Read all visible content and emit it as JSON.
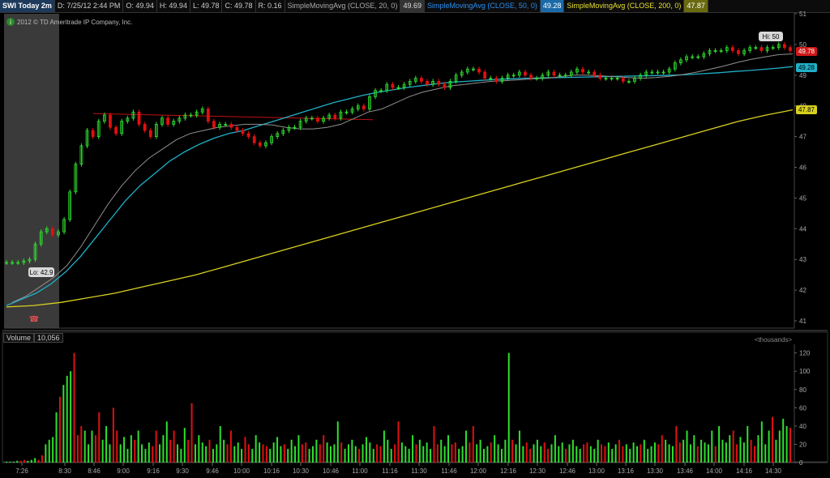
{
  "header": {
    "symbol": "SWI Today 2m",
    "date": "D: 7/25/12 2:44 PM",
    "open": "O: 49.94",
    "high": "H: 49.94",
    "low": "L: 49.78",
    "close": "C: 49.78",
    "range": "R: 0.16",
    "sma20_label": "SimpleMovingAvg (CLOSE, 20, 0)",
    "sma20_value": "49.69",
    "sma50_label": "SimpleMovingAvg (CLOSE, 50, 0)",
    "sma50_value": "49.28",
    "sma200_label": "SimpleMovingAvg (CLOSE, 200, 0)",
    "sma200_value": "47.87"
  },
  "copyright": "2012 © TD Ameritrade IP Company, Inc.",
  "annotations": {
    "hi": "Hi: 50",
    "lo": "Lo: 42.9"
  },
  "price_tags": {
    "last": "49.78",
    "sma50": "49.28",
    "sma200": "47.87"
  },
  "volume_panel": {
    "label": "Volume",
    "value": "10,056",
    "units": "<thousands>"
  },
  "colors": {
    "up": "#2ee02e",
    "down": "#e01010",
    "sma20": "#909090",
    "sma50": "#20b0c8",
    "sma200": "#d8d020",
    "resistance": "#c01010"
  },
  "chart_data": {
    "type": "candlestick",
    "price_axis": {
      "ylim": [
        41,
        51
      ],
      "ticks": [
        41,
        42,
        43,
        44,
        45,
        46,
        47,
        48,
        49,
        50,
        51
      ]
    },
    "volume_axis": {
      "ylim": [
        0,
        125
      ],
      "ticks": [
        0,
        20,
        40,
        60,
        80,
        100,
        120
      ]
    },
    "time_ticks": [
      "7:26",
      "8:30",
      "8:46",
      "9:00",
      "9:16",
      "9:30",
      "9:46",
      "10:00",
      "10:16",
      "10:30",
      "10:46",
      "11:00",
      "11:16",
      "11:30",
      "11:46",
      "12:00",
      "12:16",
      "12:30",
      "12:46",
      "13:00",
      "13:16",
      "13:30",
      "13:46",
      "14:00",
      "14:16",
      "14:30"
    ],
    "close_series": [
      42.9,
      42.9,
      42.9,
      42.95,
      43.0,
      43.5,
      43.9,
      44.0,
      43.8,
      43.9,
      44.3,
      45.2,
      46.1,
      46.7,
      47.2,
      47.0,
      47.5,
      47.7,
      47.3,
      47.1,
      47.5,
      47.6,
      47.8,
      47.4,
      47.2,
      47.0,
      47.4,
      47.6,
      47.4,
      47.5,
      47.6,
      47.7,
      47.7,
      47.8,
      47.9,
      47.5,
      47.3,
      47.4,
      47.4,
      47.3,
      47.2,
      47.1,
      47.0,
      46.8,
      46.7,
      46.8,
      47.0,
      47.1,
      47.2,
      47.3,
      47.3,
      47.5,
      47.6,
      47.6,
      47.5,
      47.6,
      47.7,
      47.6,
      47.8,
      47.8,
      47.9,
      48.0,
      47.9,
      48.3,
      48.5,
      48.5,
      48.7,
      48.6,
      48.6,
      48.7,
      48.8,
      48.9,
      48.8,
      48.7,
      48.8,
      48.7,
      48.6,
      48.8,
      49.0,
      49.1,
      49.2,
      49.2,
      49.1,
      48.9,
      48.9,
      48.8,
      48.9,
      49.0,
      49.0,
      49.1,
      49.0,
      48.9,
      48.9,
      49.0,
      49.1,
      49.0,
      49.0,
      49.0,
      49.1,
      49.2,
      49.1,
      49.1,
      49.0,
      48.9,
      48.9,
      48.9,
      48.9,
      48.8,
      48.8,
      48.9,
      49.0,
      49.1,
      49.1,
      49.1,
      49.1,
      49.2,
      49.4,
      49.5,
      49.6,
      49.6,
      49.6,
      49.7,
      49.8,
      49.8,
      49.8,
      49.9,
      49.8,
      49.7,
      49.8,
      49.9,
      49.9,
      49.8,
      49.9,
      49.9,
      50.0,
      49.9,
      49.8
    ],
    "sma20_series": [
      41.6,
      41.8,
      42.1,
      42.4,
      42.8,
      43.4,
      44.1,
      44.8,
      45.4,
      45.9,
      46.3,
      46.6,
      46.9,
      47.1,
      47.2,
      47.3,
      47.35,
      47.4,
      47.4,
      47.38,
      47.3,
      47.25,
      47.25,
      47.3,
      47.4,
      47.6,
      47.8,
      47.9,
      48.1,
      48.3,
      48.45,
      48.55,
      48.65,
      48.7,
      48.75,
      48.8,
      48.82,
      48.85,
      48.88,
      48.9,
      48.95,
      49.0,
      49.0,
      48.98,
      48.95,
      48.92,
      48.9,
      48.92,
      48.96,
      49.02,
      49.1,
      49.2,
      49.3,
      49.42,
      49.52,
      49.6,
      49.67,
      49.69
    ],
    "sma50_series": [
      41.5,
      41.7,
      41.9,
      42.2,
      42.6,
      43.1,
      43.7,
      44.3,
      44.9,
      45.4,
      45.8,
      46.2,
      46.5,
      46.75,
      46.95,
      47.1,
      47.2,
      47.35,
      47.5,
      47.65,
      47.8,
      47.95,
      48.1,
      48.22,
      48.34,
      48.44,
      48.52,
      48.6,
      48.66,
      48.72,
      48.77,
      48.8,
      48.83,
      48.86,
      48.88,
      48.9,
      48.91,
      48.92,
      48.93,
      48.94,
      48.95,
      48.96,
      48.97,
      48.98,
      48.99,
      49.0,
      49.02,
      49.05,
      49.08,
      49.12,
      49.15,
      49.19,
      49.23,
      49.28
    ],
    "sma200_series": [
      41.45,
      41.5,
      41.6,
      41.75,
      41.9,
      42.1,
      42.3,
      42.5,
      42.75,
      43.0,
      43.25,
      43.5,
      43.75,
      44.0,
      44.25,
      44.5,
      44.75,
      45.0,
      45.25,
      45.5,
      45.75,
      46.0,
      46.25,
      46.5,
      46.75,
      47.0,
      47.25,
      47.5,
      47.7,
      47.87
    ],
    "resistance_line": {
      "from": 47.75,
      "to": 47.55
    },
    "volume_values": [
      1,
      1,
      1,
      2,
      2,
      3,
      2,
      3,
      5,
      3,
      8,
      20,
      25,
      28,
      55,
      72,
      85,
      95,
      100,
      120,
      30,
      40,
      35,
      20,
      35,
      30,
      55,
      25,
      40,
      20,
      60,
      35,
      20,
      28,
      15,
      30,
      25,
      35,
      20,
      15,
      22,
      18,
      35,
      20,
      30,
      45,
      25,
      35,
      20,
      15,
      38,
      25,
      65,
      20,
      30,
      22,
      18,
      25,
      15,
      20,
      40,
      25,
      20,
      35,
      18,
      22,
      15,
      28,
      20,
      15,
      30,
      22,
      20,
      18,
      15,
      22,
      28,
      18,
      20,
      15,
      25,
      18,
      30,
      20,
      22,
      15,
      18,
      25,
      20,
      30,
      22,
      18,
      20,
      45,
      22,
      15,
      20,
      25,
      18,
      15,
      20,
      28,
      22,
      15,
      20,
      18,
      35,
      25,
      15,
      20,
      45,
      22,
      18,
      15,
      30,
      20,
      25,
      18,
      22,
      15,
      40,
      20,
      25,
      18,
      30,
      20,
      22,
      15,
      18,
      35,
      22,
      40,
      20,
      25,
      15,
      18,
      22,
      30,
      20,
      15,
      25,
      120,
      25,
      20,
      35,
      18,
      22,
      15,
      20,
      25,
      18,
      22,
      15,
      20,
      30,
      18,
      22,
      15,
      20,
      25,
      18,
      15,
      20,
      22,
      18,
      15,
      25,
      20,
      18,
      22,
      15,
      20,
      25,
      18,
      20,
      15,
      22,
      18,
      20,
      25,
      15,
      18,
      22,
      20,
      30,
      25,
      20,
      18,
      40,
      22,
      25,
      35,
      20,
      30,
      18,
      25,
      22,
      20,
      35,
      18,
      40,
      25,
      22,
      30,
      35,
      20,
      28,
      22,
      40,
      25,
      18,
      30,
      45,
      20,
      35,
      50,
      25,
      35,
      48,
      40,
      38
    ],
    "volume_up_ratio": 0.68
  }
}
